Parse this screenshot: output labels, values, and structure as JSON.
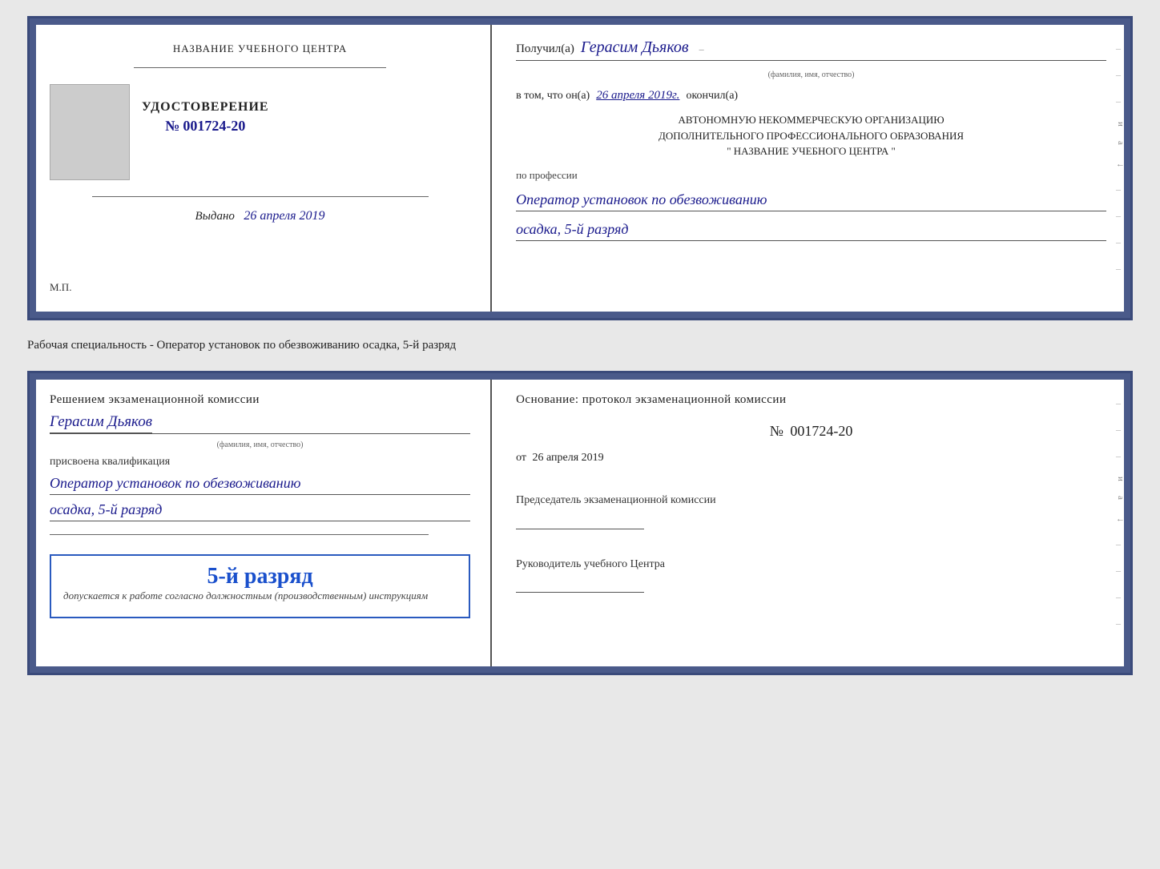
{
  "top_cert": {
    "left": {
      "org_name": "НАЗВАНИЕ УЧЕБНОГО ЦЕНТРА",
      "cert_label": "УДОСТОВЕРЕНИЕ",
      "cert_number_prefix": "№",
      "cert_number": "001724-20",
      "issued_label": "Выдано",
      "issued_date": "26 апреля 2019",
      "mp_label": "М.П."
    },
    "right": {
      "received_label": "Получил(а)",
      "recipient_name": "Герасим Дьяков",
      "recipient_subtitle": "(фамилия, имя, отчество)",
      "in_tom_label": "в том, что он(а)",
      "handwritten_date": "26 апреля 2019г.",
      "okonchil_label": "окончил(а)",
      "org_text_line1": "АВТОНОМНУЮ НЕКОММЕРЧЕСКУЮ ОРГАНИЗАЦИЮ",
      "org_text_line2": "ДОПОЛНИТЕЛЬНОГО ПРОФЕССИОНАЛЬНОГО ОБРАЗОВАНИЯ",
      "org_text_line3": "\" НАЗВАНИЕ УЧЕБНОГО ЦЕНТРА \"",
      "profession_label": "по профессии",
      "profession_value": "Оператор установок по обезвоживанию",
      "subgrade_value": "осадка, 5-й разряд"
    }
  },
  "specialty_label": "Рабочая специальность - Оператор установок по обезвоживанию осадка, 5-й разряд",
  "bottom_cert": {
    "left": {
      "decision_title": "Решением экзаменационной комиссии",
      "name": "Герасим Дьяков",
      "name_subtitle": "(фамилия, имя, отчество)",
      "assigned_label": "присвоена квалификация",
      "profession_value": "Оператор установок по обезвоживанию",
      "grade_value": "осадка, 5-й разряд",
      "stamp_grade": "5-й разряд",
      "stamp_desc": "допускается к работе согласно должностным (производственным) инструкциям"
    },
    "right": {
      "basis_label": "Основание: протокол экзаменационной комиссии",
      "protocol_number_prefix": "№",
      "protocol_number": "001724-20",
      "date_prefix": "от",
      "protocol_date": "26 апреля 2019",
      "chairman_label": "Председатель экзаменационной комиссии",
      "director_label": "Руководитель учебного Центра"
    }
  }
}
